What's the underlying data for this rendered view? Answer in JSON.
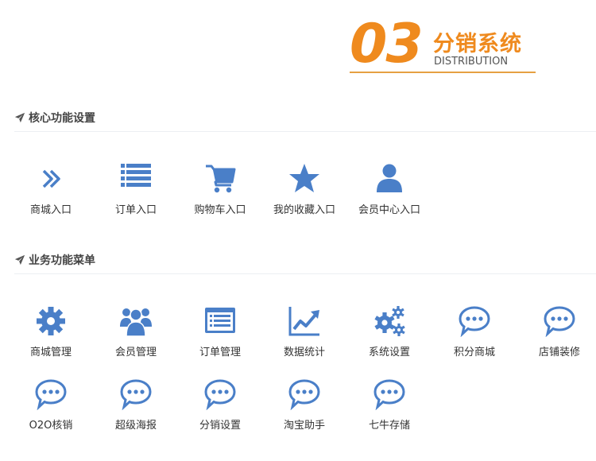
{
  "header": {
    "number": "03",
    "title": "分销系统",
    "subtitle": "DISTRIBUTION"
  },
  "colors": {
    "accent": "#ef8a1e",
    "icon": "#4a7fc8"
  },
  "core_section": {
    "title": "核心功能设置",
    "items": [
      {
        "label": "商城入口",
        "icon": "double-chevron-right-icon"
      },
      {
        "label": "订单入口",
        "icon": "list-icon"
      },
      {
        "label": "购物车入口",
        "icon": "shopping-cart-icon"
      },
      {
        "label": "我的收藏入口",
        "icon": "star-icon"
      },
      {
        "label": "会员中心入口",
        "icon": "user-icon"
      }
    ]
  },
  "business_section": {
    "title": "业务功能菜单",
    "items": [
      {
        "label": "商城管理",
        "icon": "gear-icon"
      },
      {
        "label": "会员管理",
        "icon": "users-icon"
      },
      {
        "label": "订单管理",
        "icon": "order-list-icon"
      },
      {
        "label": "数据统计",
        "icon": "line-chart-icon"
      },
      {
        "label": "系统设置",
        "icon": "gears-icon"
      },
      {
        "label": "积分商城",
        "icon": "chat-bubble-icon"
      },
      {
        "label": "店铺装修",
        "icon": "chat-bubble-icon"
      },
      {
        "label": "O2O核销",
        "icon": "chat-bubble-icon"
      },
      {
        "label": "超级海报",
        "icon": "chat-bubble-icon"
      },
      {
        "label": "分销设置",
        "icon": "chat-bubble-icon"
      },
      {
        "label": "淘宝助手",
        "icon": "chat-bubble-icon"
      },
      {
        "label": "七牛存储",
        "icon": "chat-bubble-icon"
      }
    ]
  }
}
